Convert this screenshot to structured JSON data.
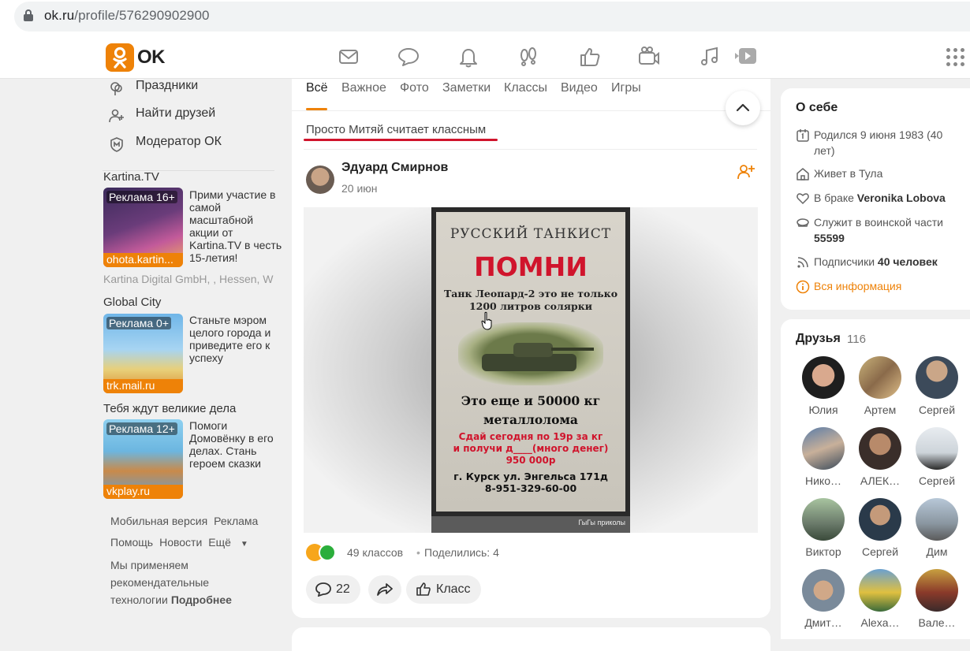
{
  "browser": {
    "url_domain": "ok.ru",
    "url_path": "/profile/576290902900"
  },
  "header": {
    "logo_text": "OK",
    "nav_icons": [
      "mail-icon",
      "chat-icon",
      "bell-icon",
      "guests-icon",
      "like-icon",
      "video-call-icon",
      "music-icon",
      "video-icon",
      "apps-grid-icon"
    ]
  },
  "left_menu": {
    "items": [
      {
        "label": "Праздники",
        "icon": "balloons-icon"
      },
      {
        "label": "Найти друзей",
        "icon": "add-friend-icon"
      },
      {
        "label": "Модератор ОК",
        "icon": "moderator-icon"
      }
    ]
  },
  "ads": [
    {
      "title": "Kartina.TV",
      "badge": "Реклама 16+",
      "domain": "ohota.kartin...",
      "text": "Прими участие в самой масштабной акции от Kartina.TV в честь 15-летия!",
      "company": "Kartina Digital GmbH, , Hessen, W"
    },
    {
      "title": "Global City",
      "badge": "Реклама 0+",
      "domain": "trk.mail.ru",
      "text": "Станьте мэром целого города и приведите его к успеху"
    },
    {
      "title": "Тебя ждут великие дела",
      "badge": "Реклама 12+",
      "domain": "vkplay.ru",
      "text": "Помоги Домовёнку в его делах. Стань героем сказки"
    }
  ],
  "footer": {
    "mobile": "Мобильная версия",
    "ads": "Реклама",
    "help": "Помощь",
    "news": "Новости",
    "more": "Ещё",
    "notice": "Мы применяем рекомендательные технологии",
    "more_link": "Подробнее"
  },
  "feed": {
    "tabs": [
      "Всё",
      "Важное",
      "Фото",
      "Заметки",
      "Классы",
      "Видео",
      "Игры"
    ],
    "active_tab": "Всё",
    "context_line": "Просто Митяй считает классным",
    "post": {
      "author": "Эдуард Смирнов",
      "date": "20 июн",
      "poster": {
        "line1": "РУССКИЙ ТАНКИСТ",
        "line2": "ПОМНИ",
        "line3a": "Танк Леопард-2 это не только",
        "line3b": "1200 литров солярки",
        "line4a": "Это еще и 50000 кг",
        "line4b": "металлолома",
        "line5a": "Сдай сегодня по 19р за кг",
        "line5b": "и получи д____(много денег)",
        "line5c": "950 000р",
        "line6a": "г. Курск ул. Энгельса 171д",
        "line6b": "8-951-329-60-00",
        "watermark": "ГыГы приколы"
      },
      "classes_count": "49 классов",
      "dot": "•",
      "shared": "Поделились: 4",
      "comments_count": "22",
      "class_label": "Класс"
    }
  },
  "about": {
    "title": "О себе",
    "born": "Родился 9 июня 1983 (40 лет)",
    "lives_prefix": "Живет в Тула",
    "married_prefix": "В браке",
    "married_name": "Veronika Lobova",
    "serves_prefix": "Служит в воинской части",
    "serves_unit": "55599",
    "subs_prefix": "Подписчики",
    "subs_count": "40 человек",
    "all_info": "Вся информация"
  },
  "friends": {
    "title": "Друзья",
    "count": "116",
    "list": [
      "Юлия",
      "Артем",
      "Сергей",
      "Нико…",
      "АЛЕК…",
      "Сергей",
      "Виктор",
      "Сергей",
      "Дим",
      "Дмит…",
      "Alexa…",
      "Вале…"
    ]
  },
  "colors": {
    "brand": "#ee8208",
    "accent_red": "#d0142c"
  }
}
